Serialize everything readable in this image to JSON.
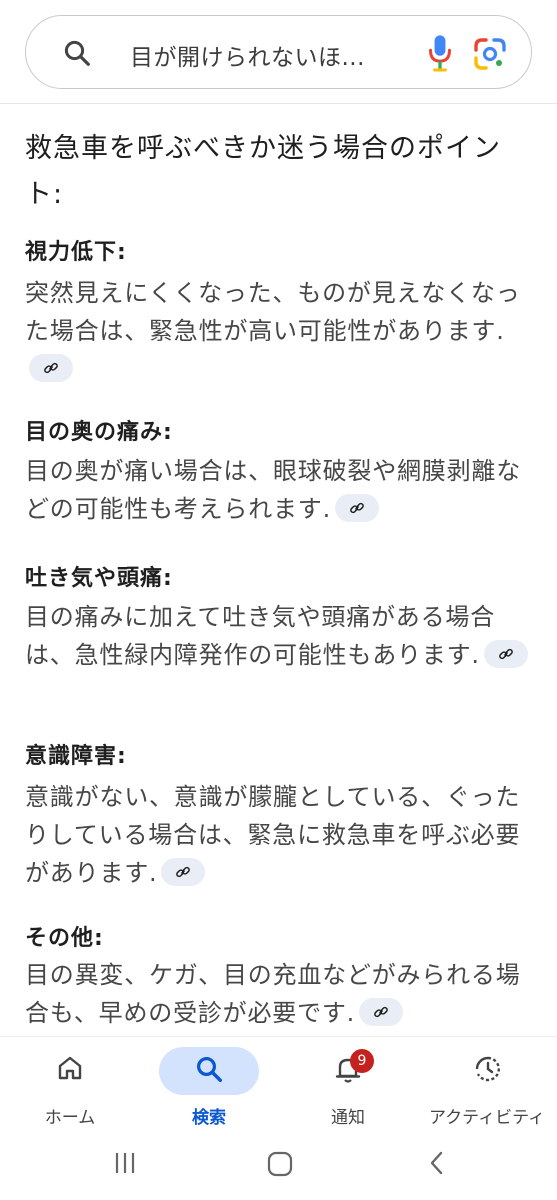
{
  "search": {
    "query": "目が開けられないほ...",
    "search_icon": "search-icon",
    "mic_icon": "mic-icon",
    "lens_icon": "google-lens-icon"
  },
  "content": {
    "intro": "救急車を呼ぶべきか迷う場合のポイント:",
    "sections": [
      {
        "title": "視力低下:",
        "body": "突然見えにくくなった、ものが見えなくなった場合は、緊急性が高い可能性があります."
      },
      {
        "title": "目の奥の痛み:",
        "body": "目の奥が痛い場合は、眼球破裂や網膜剥離などの可能性も考えられます."
      },
      {
        "title": "吐き気や頭痛:",
        "body": "目の痛みに加えて吐き気や頭痛がある場合は、急性緑内障発作の可能性もあります."
      },
      {
        "title": "意識障害:",
        "body": "意識がない、意識が朦朧としている、ぐったりしている場合は、緊急に救急車を呼ぶ必要があります."
      },
      {
        "title": "その他:",
        "body": "目の異変、ケガ、目の充血などがみられる場合も、早めの受診が必要です."
      }
    ]
  },
  "bottom_nav": {
    "items": [
      {
        "label": "ホーム",
        "icon": "home-icon"
      },
      {
        "label": "検索",
        "icon": "search-icon",
        "active": true
      },
      {
        "label": "通知",
        "icon": "bell-icon",
        "badge": "9"
      },
      {
        "label": "アクティビティ",
        "icon": "activity-icon"
      }
    ]
  },
  "system_nav": {
    "icons": [
      "recent-apps-icon",
      "home-circle-icon",
      "back-icon"
    ]
  },
  "colors": {
    "accent": "#0b57d0",
    "active_pill": "#d3e3fd",
    "badge": "#c5221f",
    "link_chip": "#e9eef6"
  }
}
